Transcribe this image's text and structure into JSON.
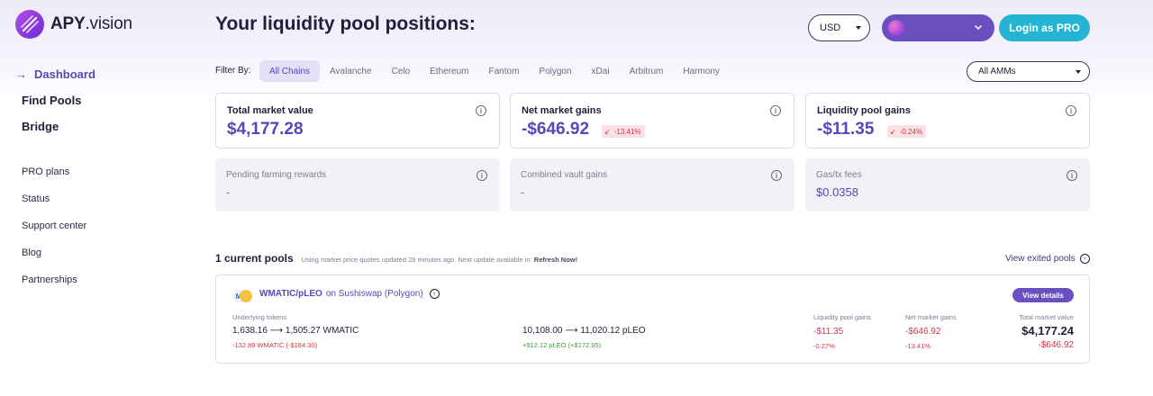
{
  "app": {
    "logo_text_bold": "APY",
    "logo_text_light": ".vision"
  },
  "sidebar": {
    "main_items": [
      {
        "label": "Dashboard",
        "active": true
      },
      {
        "label": "Find Pools",
        "active": false
      },
      {
        "label": "Bridge",
        "active": false
      }
    ],
    "sub_items": [
      "PRO plans",
      "Status",
      "Support center",
      "Blog",
      "Partnerships"
    ]
  },
  "header": {
    "title": "Your liquidity pool positions:",
    "currency": "USD",
    "login_label": "Login as PRO"
  },
  "filters": {
    "label": "Filter By:",
    "chains": [
      "All Chains",
      "Avalanche",
      "Celo",
      "Ethereum",
      "Fantom",
      "Polygon",
      "xDai",
      "Arbitrum",
      "Harmony"
    ],
    "active_chain": "All Chains",
    "amm_select": "All AMMs"
  },
  "stats": {
    "total_market_value": {
      "title": "Total market value",
      "value": "$4,177.28"
    },
    "net_market_gains": {
      "title": "Net market gains",
      "value": "-$646.92",
      "pct": "-13.41%"
    },
    "liquidity_pool_gains": {
      "title": "Liquidity pool gains",
      "value": "-$11.35",
      "pct": "-0.24%"
    },
    "pending_farming_rewards": {
      "title": "Pending farming rewards",
      "value": "-"
    },
    "combined_vault_gains": {
      "title": "Combined vault gains",
      "value": "-"
    },
    "gas_fees": {
      "title": "Gas/tx fees",
      "value": "$0.0358"
    }
  },
  "pools": {
    "heading": "1 current pools",
    "note_prefix": "Using market price quotes updated 29 minutes ago.   Next update available in:",
    "note_action": "Refresh Now!",
    "exited_link": "View exited pools",
    "items": [
      {
        "pair": "WMATIC/pLEO",
        "on_label": "on Sushiswap (Polygon)",
        "details_label": "View details",
        "underlying_label": "Underlying tokens",
        "token_a": "1,638.16 ⟶ 1,505.27 WMATIC",
        "token_a_delta": "-132.89 WMATIC (-$184.30)",
        "token_b": "10,108.00 ⟶ 11,020.12 pLEO",
        "token_b_delta": "+912.12 pLEO (+$172.95)",
        "lp_gains_label": "Liquidity pool gains",
        "lp_gains_value": "-$11.35",
        "lp_gains_pct": "-0.27%",
        "net_gains_label": "Net market gains",
        "net_gains_value": "-$646.92",
        "net_gains_pct": "-13.41%",
        "total_label": "Total market value",
        "total_value": "$4,177.24",
        "total_delta": "-$646.92"
      }
    ]
  },
  "colors": {
    "accent": "#5b46b9",
    "wallet": "#6a4fbf",
    "login": "#25b5d4",
    "negative": "#d2344a",
    "positive": "#3a9a3a"
  },
  "icons": {
    "nav_active": "arrow-right-icon",
    "info": "info-icon",
    "caret": "caret-down-icon",
    "chevron": "chevron-down-icon",
    "circle_arrow": "circle-arrow-right-icon",
    "down_arrow": "arrow-down-left-icon"
  }
}
